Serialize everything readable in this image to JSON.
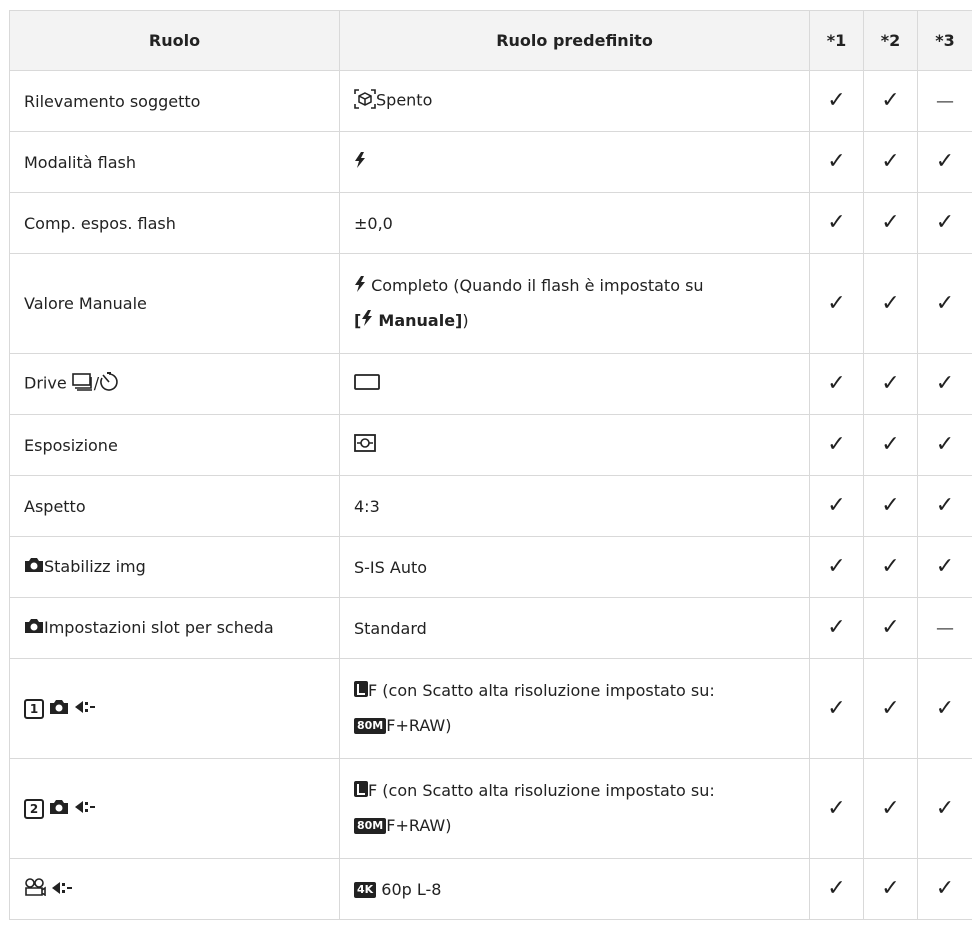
{
  "headers": {
    "ruolo": "Ruolo",
    "predefinito": "Ruolo predefinito",
    "c1": "*1",
    "c2": "*2",
    "c3": "*3"
  },
  "rows": [
    {
      "ruolo": "Rilevamento soggetto",
      "predefinito": "Spento",
      "c1": "✓",
      "c2": "✓",
      "c3": "—"
    },
    {
      "ruolo": "Modalità flash",
      "predefinito": "",
      "c1": "✓",
      "c2": "✓",
      "c3": "✓"
    },
    {
      "ruolo": "Comp. espos. flash",
      "predefinito": "±0,0",
      "c1": "✓",
      "c2": "✓",
      "c3": "✓"
    },
    {
      "ruolo": "Valore Manuale",
      "predefinito_1": "Completo (Quando il flash è impostato su",
      "predefinito_2a": "[",
      "predefinito_2b": "Manuale]",
      "predefinito_2c": ")",
      "c1": "✓",
      "c2": "✓",
      "c3": "✓"
    },
    {
      "ruolo": "Drive",
      "ruolo_sep": "/",
      "c1": "✓",
      "c2": "✓",
      "c3": "✓"
    },
    {
      "ruolo": "Esposizione",
      "c1": "✓",
      "c2": "✓",
      "c3": "✓"
    },
    {
      "ruolo": "Aspetto",
      "predefinito": "4:3",
      "c1": "✓",
      "c2": "✓",
      "c3": "✓"
    },
    {
      "ruolo": "Stabilizz img",
      "predefinito": "S-IS Auto",
      "c1": "✓",
      "c2": "✓",
      "c3": "✓"
    },
    {
      "ruolo": "Impostazioni slot per scheda",
      "predefinito": "Standard",
      "c1": "✓",
      "c2": "✓",
      "c3": "—"
    },
    {
      "slot": "1",
      "predefinito_1": "F (con Scatto alta risoluzione impostato su:",
      "tag": "80M",
      "predefinito_2": "F+RAW)",
      "c1": "✓",
      "c2": "✓",
      "c3": "✓"
    },
    {
      "slot": "2",
      "predefinito_1": "F (con Scatto alta risoluzione impostato su:",
      "tag": "80M",
      "predefinito_2": "F+RAW)",
      "c1": "✓",
      "c2": "✓",
      "c3": "✓"
    },
    {
      "tag": "4K",
      "predefinito": "60p L-8",
      "c1": "✓",
      "c2": "✓",
      "c3": "✓"
    }
  ],
  "icons": [
    "subject-detection-icon",
    "flash-icon",
    "sequential-shooting-icon",
    "self-timer-icon",
    "single-frame-icon",
    "metering-icon",
    "camera-icon",
    "card-slot-icon",
    "image-quality-icon",
    "movie-icon"
  ]
}
